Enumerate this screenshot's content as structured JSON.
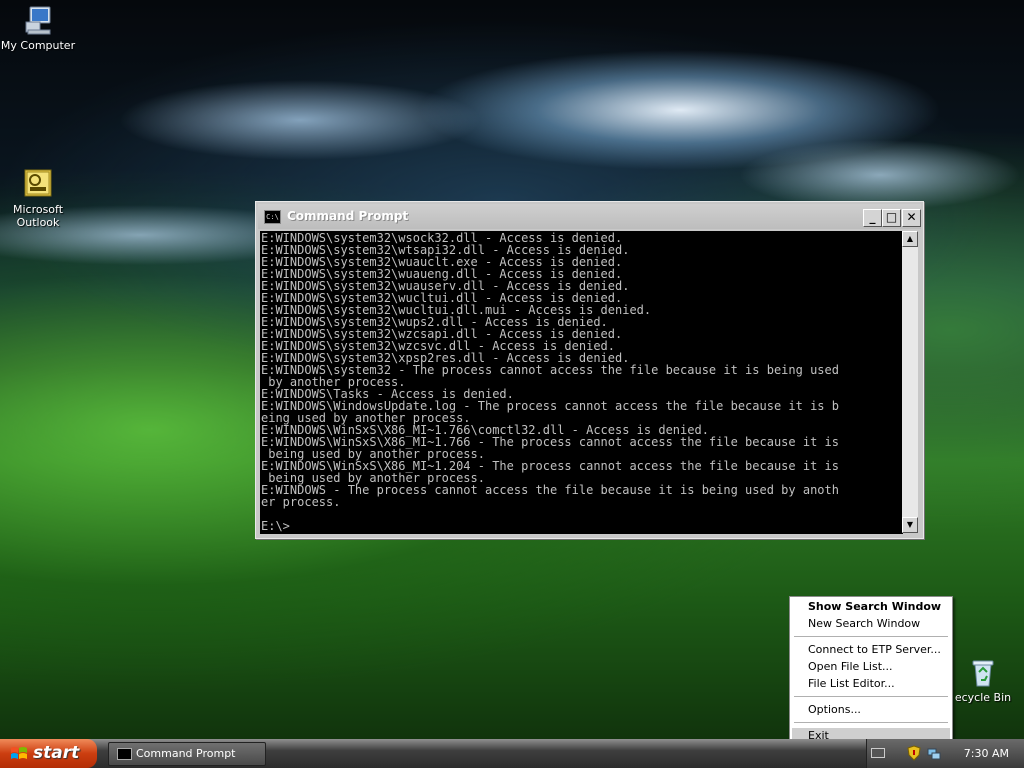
{
  "desktop": {
    "icons": [
      {
        "label": "My Computer"
      },
      {
        "label": "Microsoft\nOutlook"
      },
      {
        "label": "ecycle Bin"
      }
    ]
  },
  "cmd_window": {
    "title": "Command Prompt",
    "title_icon_text": "C:\\",
    "buttons": {
      "minimize": "_",
      "maximize": "□",
      "close": "✕"
    },
    "lines": [
      "E:WINDOWS\\system32\\wsock32.dll - Access is denied.",
      "E:WINDOWS\\system32\\wtsapi32.dll - Access is denied.",
      "E:WINDOWS\\system32\\wuauclt.exe - Access is denied.",
      "E:WINDOWS\\system32\\wuaueng.dll - Access is denied.",
      "E:WINDOWS\\system32\\wuauserv.dll - Access is denied.",
      "E:WINDOWS\\system32\\wucltui.dll - Access is denied.",
      "E:WINDOWS\\system32\\wucltui.dll.mui - Access is denied.",
      "E:WINDOWS\\system32\\wups2.dll - Access is denied.",
      "E:WINDOWS\\system32\\wzcsapi.dll - Access is denied.",
      "E:WINDOWS\\system32\\wzcsvc.dll - Access is denied.",
      "E:WINDOWS\\system32\\xpsp2res.dll - Access is denied.",
      "E:WINDOWS\\system32 - The process cannot access the file because it is being used",
      " by another process.",
      "E:WINDOWS\\Tasks - Access is denied.",
      "E:WINDOWS\\WindowsUpdate.log - The process cannot access the file because it is b",
      "eing used by another process.",
      "E:WINDOWS\\WinSxS\\X86_MI~1.766\\comctl32.dll - Access is denied.",
      "E:WINDOWS\\WinSxS\\X86_MI~1.766 - The process cannot access the file because it is",
      " being used by another process.",
      "E:WINDOWS\\WinSxS\\X86_MI~1.204 - The process cannot access the file because it is",
      " being used by another process.",
      "E:WINDOWS - The process cannot access the file because it is being used by anoth",
      "er process.",
      "",
      "E:\\>"
    ]
  },
  "context_menu": {
    "items": [
      {
        "label": "Show Search Window",
        "bold": true
      },
      {
        "label": "New Search Window"
      },
      {
        "label": "Connect to ETP Server..."
      },
      {
        "label": "Open File List..."
      },
      {
        "label": "File List Editor..."
      },
      {
        "label": "Options..."
      },
      {
        "label": "Exit",
        "highlighted": true
      }
    ]
  },
  "taskbar": {
    "start_label": "start",
    "task_button_label": "Command Prompt",
    "clock": "7:30 AM"
  },
  "colors": {
    "console_bg": "#000000",
    "console_fg": "#c0c0c0",
    "start_button": "#cc3e10",
    "menu_highlight": "#cfcfcf"
  }
}
